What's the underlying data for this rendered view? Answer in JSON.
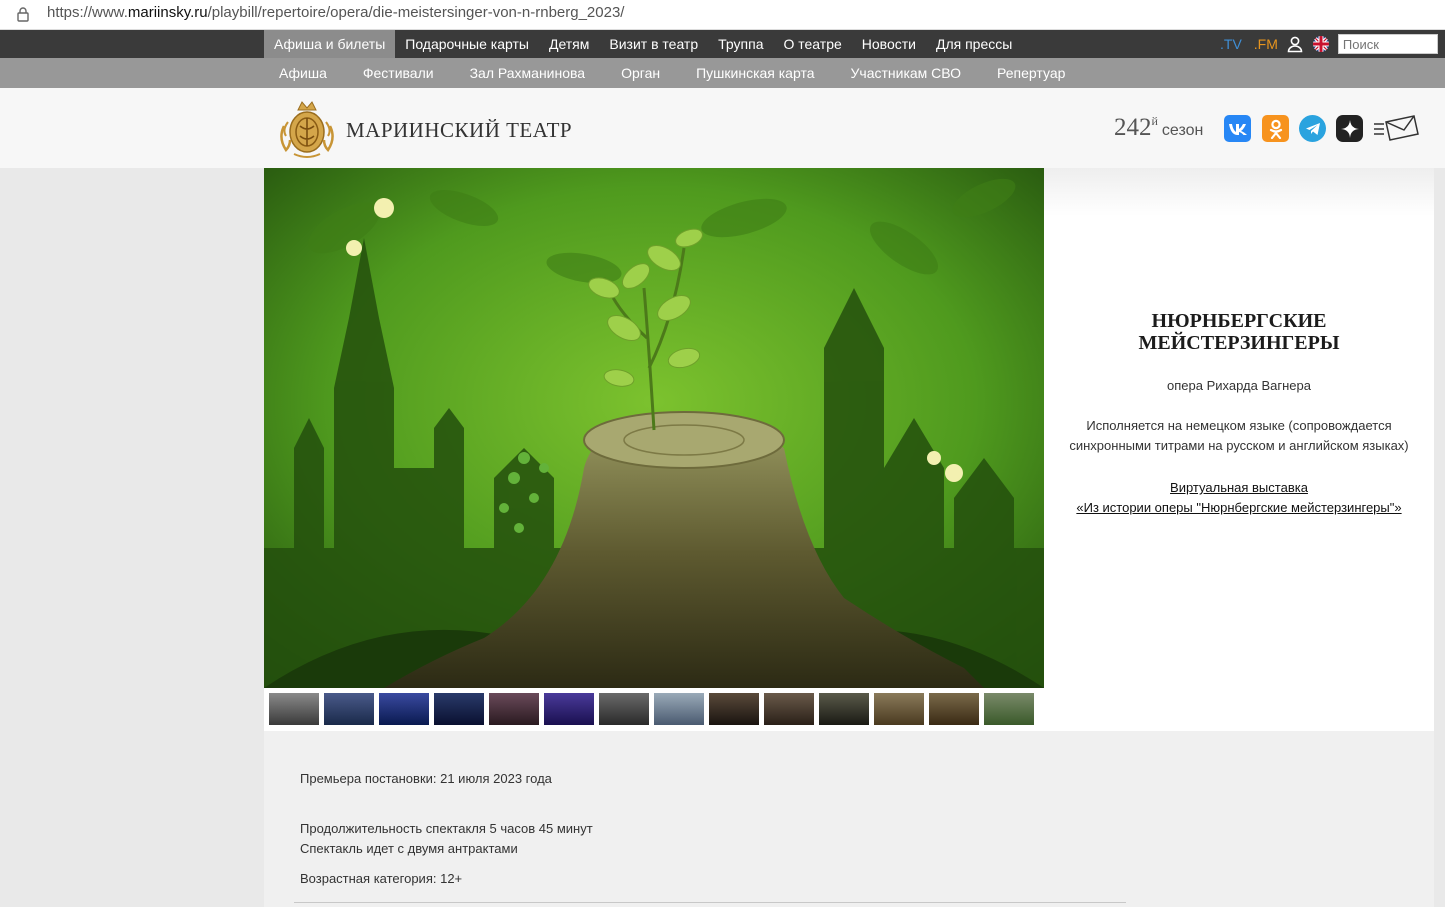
{
  "browser": {
    "url_prefix": "https://www.",
    "url_domain": "mariinsky.ru",
    "url_path": "/playbill/repertoire/opera/die-meistersinger-von-n-rnberg_2023/"
  },
  "nav_primary": {
    "items": [
      {
        "label": "Афиша и билеты",
        "active": true
      },
      {
        "label": "Подарочные карты"
      },
      {
        "label": "Детям"
      },
      {
        "label": "Визит в театр"
      },
      {
        "label": "Труппа"
      },
      {
        "label": "О театре"
      },
      {
        "label": "Новости"
      },
      {
        "label": "Для прессы"
      }
    ],
    "tv_label": ".TV",
    "fm_label": ".FM",
    "search_placeholder": "Поиск"
  },
  "nav_secondary": {
    "items": [
      "Афиша",
      "Фестивали",
      "Зал Рахманинова",
      "Орган",
      "Пушкинская карта",
      "Участникам СВО",
      "Репертуар"
    ]
  },
  "header": {
    "logo_text": "МАРИИНСКИЙ ТЕАТР",
    "season_number": "242",
    "season_suffix": "й",
    "season_word": "сезон",
    "vk_label": "vk",
    "ok_label": "ok",
    "tg_label": "tg",
    "zen_label": "zen"
  },
  "performance": {
    "title_line1": "НЮРНБЕРГСКИЕ",
    "title_line2": "МЕЙСТЕРЗИНГЕРЫ",
    "subtitle": "опера Рихарда Вагнера",
    "language_line1": "Исполняется на немецком языке (сопровождается",
    "language_line2": "синхронными титрами на русском и английском языках)",
    "exhibit_link_line1": "Виртуальная выставка",
    "exhibit_link_line2": "«Из истории оперы \"Нюрнбергские мейстерзингеры\"»"
  },
  "details": {
    "premiere": "Премьера постановки: 21 июля 2023 года",
    "duration": "Продолжительность спектакля 5 часов 45 минут",
    "intermissions": "Спектакль идет с двумя антрактами",
    "age": "Возрастная категория: 12+"
  },
  "colors": {
    "nav_dark": "#3a3a3a",
    "nav_active": "#8c8c8c",
    "nav_light": "#989898",
    "tv": "#3f8fd6",
    "fm": "#e8951e",
    "hero_green": "#4f9a1e"
  },
  "icons": [
    "lock-icon",
    "user-icon",
    "uk-flag-icon",
    "theatre-emblem-icon",
    "vk-icon",
    "ok-icon",
    "telegram-icon",
    "zen-icon",
    "mail-menu-icon"
  ]
}
